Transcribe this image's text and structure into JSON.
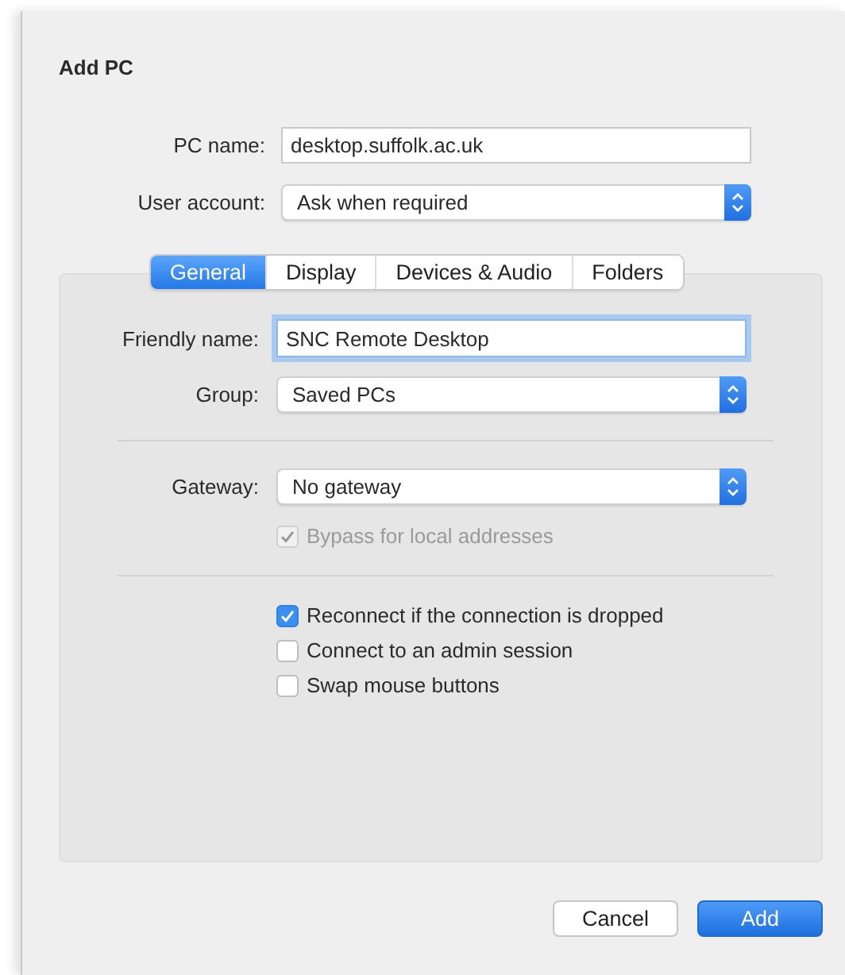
{
  "dialog": {
    "title": "Add PC"
  },
  "fields": [
    {
      "label": "PC name:",
      "kind": "text",
      "value": "desktop.suffolk.ac.uk",
      "focused": false
    },
    {
      "label": "User account:",
      "kind": "select",
      "value": "Ask when required"
    }
  ],
  "tabs": [
    {
      "label": "General",
      "selected": true
    },
    {
      "label": "Display",
      "selected": false
    },
    {
      "label": "Devices & Audio",
      "selected": false
    },
    {
      "label": "Folders",
      "selected": false
    }
  ],
  "general": {
    "fields": [
      {
        "label": "Friendly name:",
        "kind": "text",
        "value": "SNC Remote Desktop",
        "focused": true
      },
      {
        "label": "Group:",
        "kind": "select",
        "value": "Saved PCs"
      }
    ],
    "gateway": {
      "label": "Gateway:",
      "kind": "select",
      "value": "No gateway"
    },
    "bypass": {
      "label": "Bypass for local addresses",
      "checked": true,
      "disabled": true
    },
    "options": [
      {
        "label": "Reconnect if the connection is dropped",
        "checked": true,
        "disabled": false
      },
      {
        "label": "Connect to an admin session",
        "checked": false,
        "disabled": false
      },
      {
        "label": "Swap mouse buttons",
        "checked": false,
        "disabled": false
      }
    ]
  },
  "buttons": [
    {
      "label": "Cancel",
      "kind": "default"
    },
    {
      "label": "Add",
      "kind": "primary"
    }
  ]
}
